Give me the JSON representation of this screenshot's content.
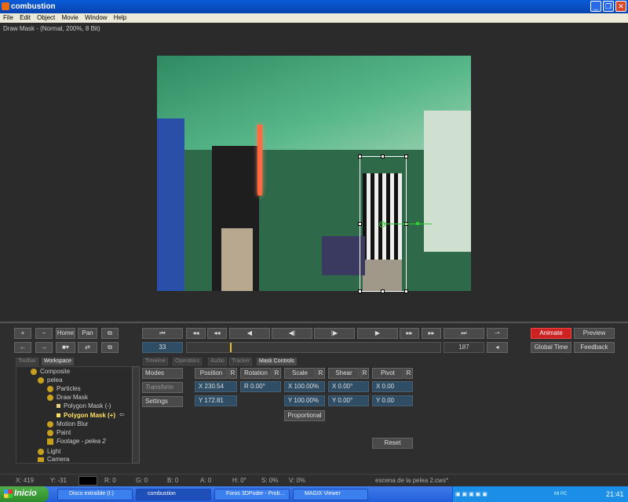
{
  "window": {
    "title": "combustion"
  },
  "menu": [
    "File",
    "Edit",
    "Object",
    "Movie",
    "Window",
    "Help"
  ],
  "viewer_status": "Draw Mask -  (Normal, 200%, 8 Bit)",
  "transport": {
    "home_label": "Home",
    "pan_label": "Pan",
    "current_frame": "33",
    "end_frame": "187",
    "animate_label": "Animate",
    "preview_label": "Preview",
    "global_time_label": "Global Time",
    "feedback_label": "Feedback"
  },
  "left_tabs": [
    "Toolbar",
    "Workspace"
  ],
  "right_tabs": [
    "Timeline",
    "Operators",
    "Audio",
    "Tracker",
    "Mask Controls"
  ],
  "tree": [
    {
      "label": "Composite"
    },
    {
      "label": "pelea"
    },
    {
      "label": "Particles"
    },
    {
      "label": "Draw Mask"
    },
    {
      "label": "Polygon Mask (-)"
    },
    {
      "label": "Polygon Mask (+)"
    },
    {
      "label": "Motion Blur"
    },
    {
      "label": "Paint"
    },
    {
      "label": "Footage - pelea 2"
    },
    {
      "label": "Light"
    },
    {
      "label": "Camera"
    }
  ],
  "mask_controls": {
    "side_buttons": [
      "Modes",
      "Transform",
      "Settings"
    ],
    "columns": [
      "Position",
      "Rotation",
      "Scale",
      "Shear",
      "Pivot"
    ],
    "r_label": "R",
    "position": {
      "x": "X 230.54",
      "y": "Y 172.81"
    },
    "rotation": "R 0.00°",
    "scale": {
      "x": "X 100.00%",
      "y": "Y 100.00%"
    },
    "shear": {
      "x": "X 0.00°",
      "y": "Y 0.00°"
    },
    "pivot": {
      "x": "X 0.00",
      "y": "Y 0.00"
    },
    "proportional_label": "Proportional",
    "reset_label": "Reset"
  },
  "status": {
    "x": "X:  419",
    "y": "Y:  -31",
    "r": "R: 0",
    "g": "G: 0",
    "b": "B: 0",
    "a": "A: 0",
    "h": "H: 0°",
    "s": "S: 0%",
    "v": "V: 0%",
    "file": "escena de la pelea 2.cws*"
  },
  "taskbar": {
    "start": "Inicio",
    "tasks": [
      "Disco extraíble (I:)",
      "combustion",
      "Foros 3DPoder - Prob...",
      "MAGIX Viewer"
    ],
    "clock": "21:41",
    "tray_label": "Mi PC"
  },
  "colors": {
    "animate": "#cc2222",
    "accent": "#0a5bd8"
  }
}
